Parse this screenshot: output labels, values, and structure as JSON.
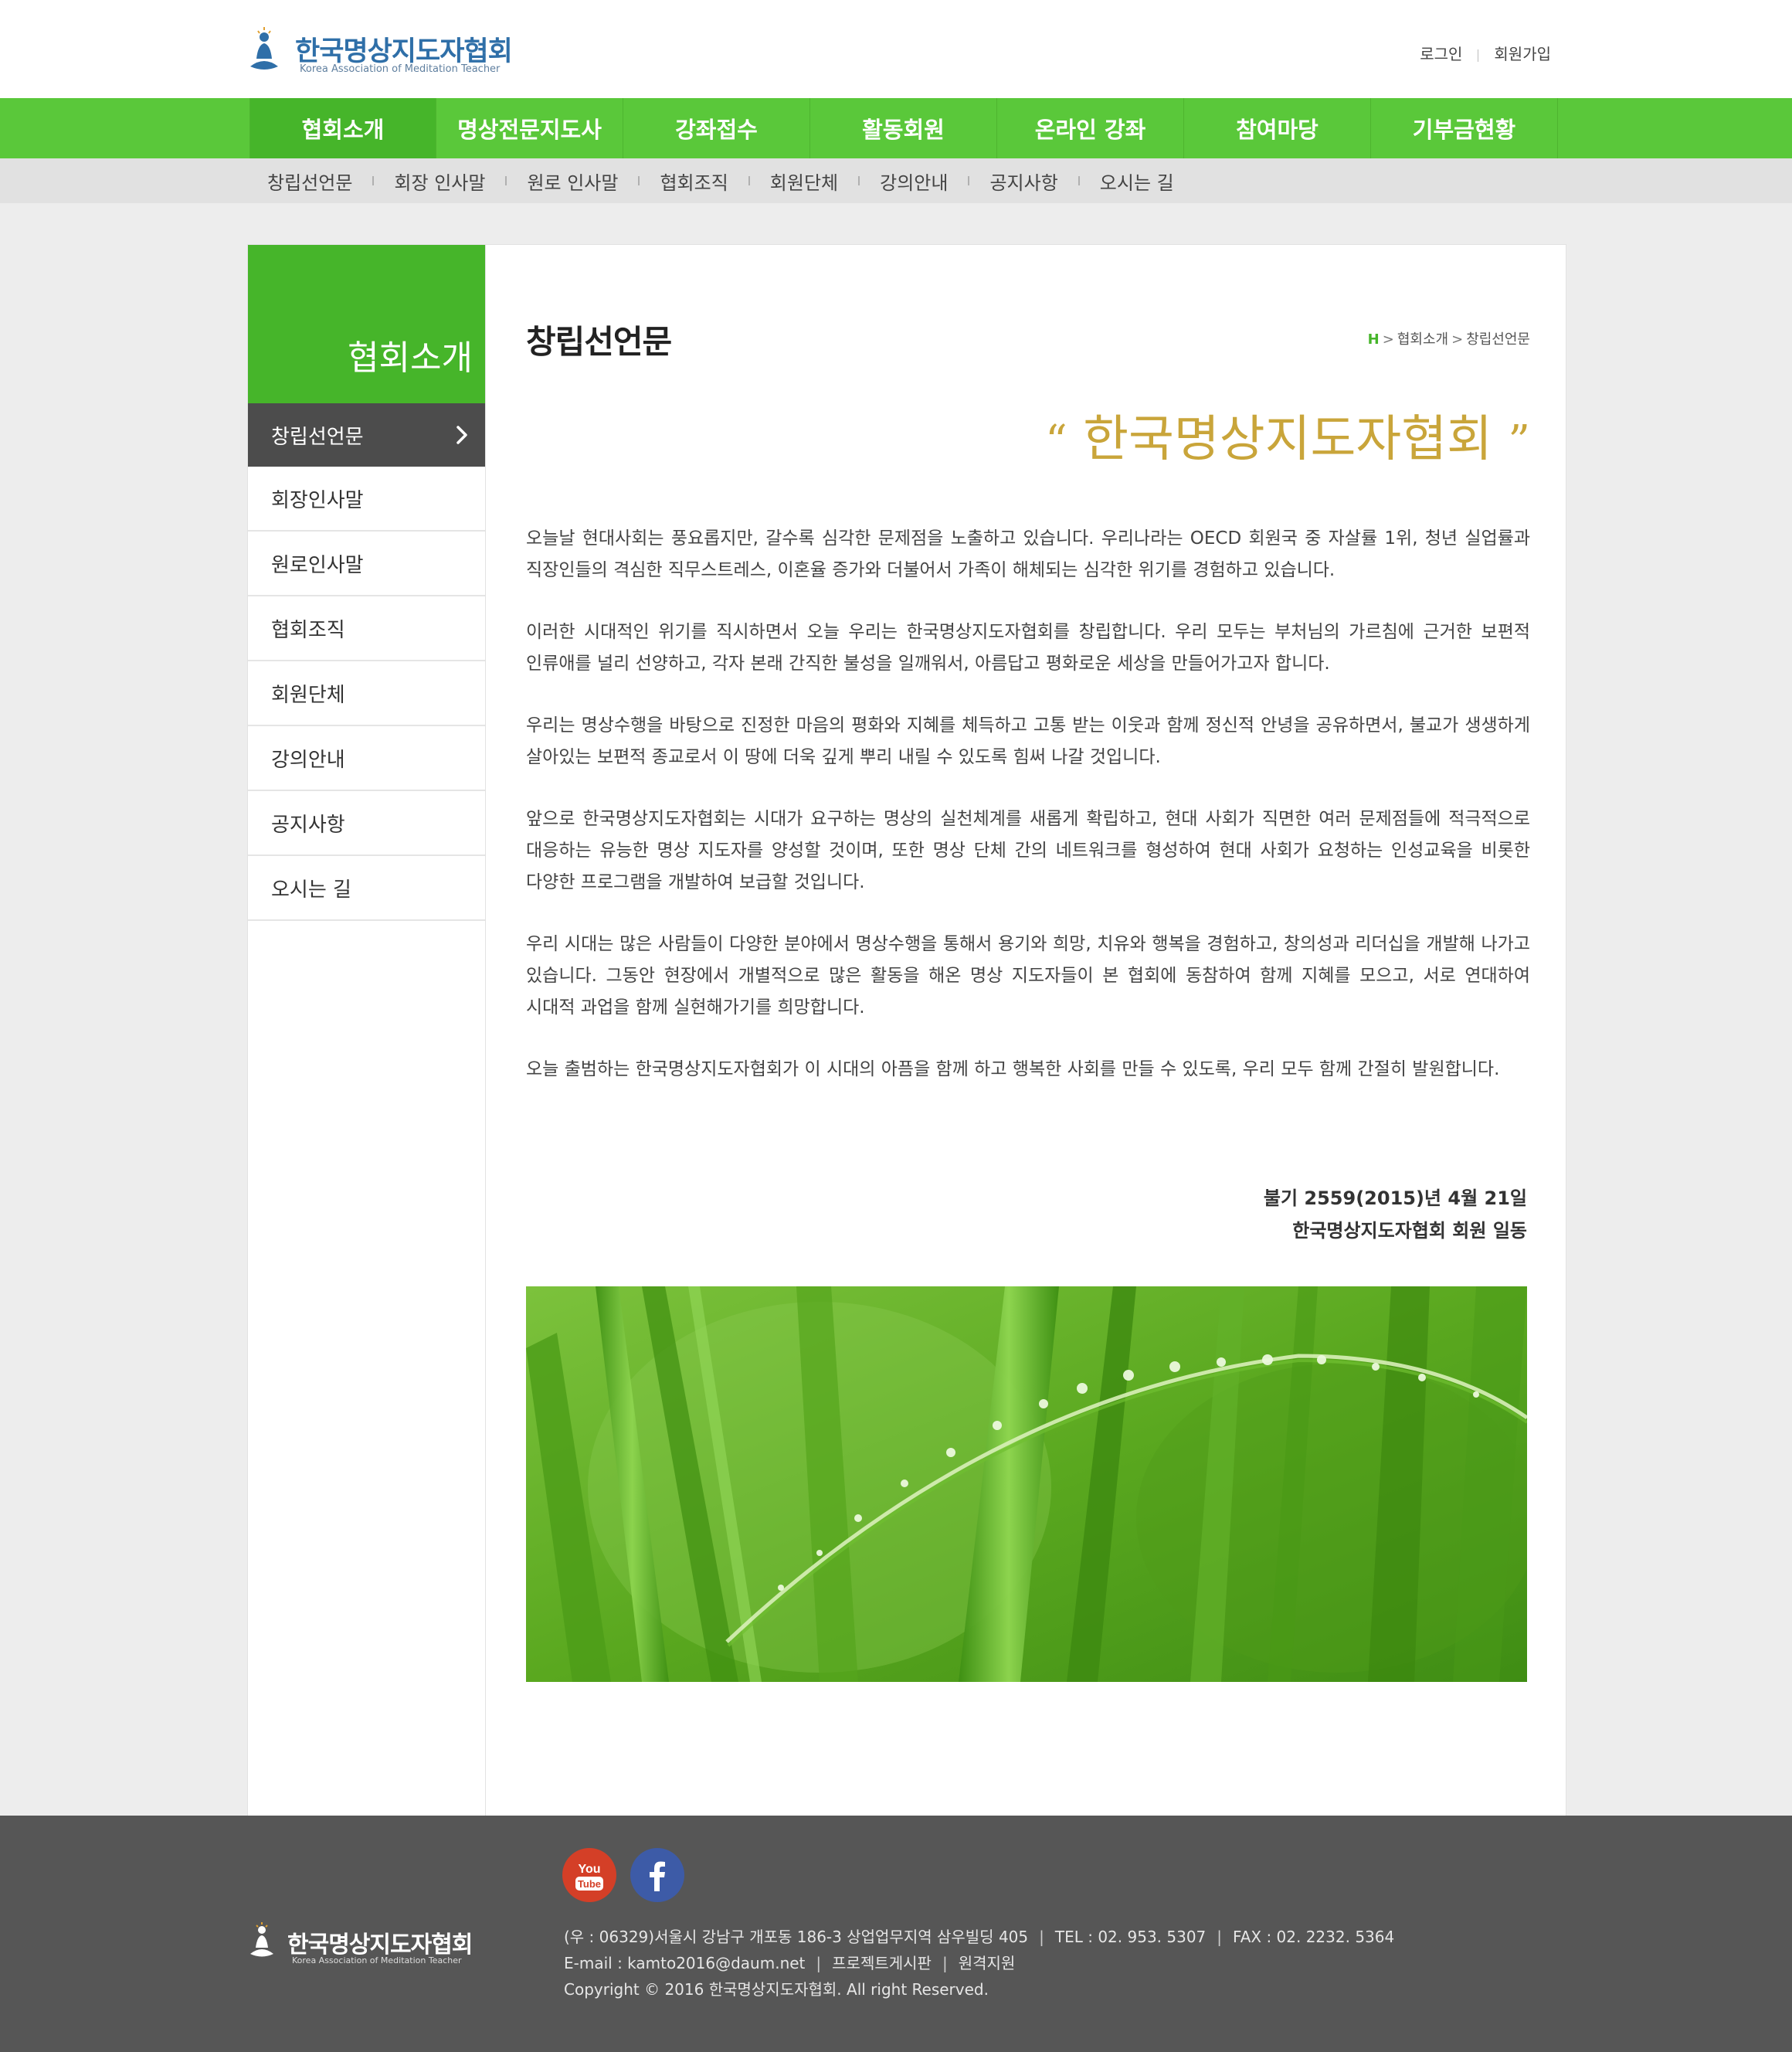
{
  "header": {
    "logo_ko": "한국명상지도자협회",
    "logo_en": "Korea Association of Meditation Teacher",
    "login": "로그인",
    "signup": "회원가입"
  },
  "gnb": {
    "items": [
      "협회소개",
      "명상전문지도사",
      "강좌접수",
      "활동회원",
      "온라인 강좌",
      "참여마당",
      "기부금현황"
    ]
  },
  "subnav": {
    "items": [
      "창립선언문",
      "회장 인사말",
      "원로 인사말",
      "협회조직",
      "회원단체",
      "강의안내",
      "공지사항",
      "오시는 길"
    ]
  },
  "lnb": {
    "title": "협회소개",
    "items": [
      "창립선언문",
      "회장인사말",
      "원로인사말",
      "협회조직",
      "회원단체",
      "강의안내",
      "공지사항",
      "오시는 길"
    ]
  },
  "main": {
    "title": "창립선언문",
    "breadcrumb": {
      "home": "H",
      "level1": "협회소개",
      "level2": "창립선언문"
    },
    "quote_open": "“",
    "quote": "한국명상지도자협회",
    "quote_close": "”",
    "paragraphs": [
      "오늘날 현대사회는 풍요롭지만, 갈수록 심각한 문제점을 노출하고 있습니다. 우리나라는 OECD 회원국 중 자살률 1위, 청년 실업률과 직장인들의 격심한 직무스트레스, 이혼율 증가와 더불어서 가족이 해체되는 심각한 위기를 경험하고 있습니다.",
      "이러한 시대적인 위기를 직시하면서 오늘 우리는 한국명상지도자협회를 창립합니다. 우리 모두는 부처님의 가르침에 근거한 보편적 인류애를 널리 선양하고, 각자 본래 간직한 불성을 일깨워서, 아름답고 평화로운 세상을 만들어가고자 합니다.",
      "우리는 명상수행을 바탕으로 진정한 마음의 평화와 지혜를 체득하고 고통 받는 이웃과 함께 정신적 안녕을 공유하면서, 불교가 생생하게 살아있는 보편적 종교로서 이 땅에 더욱 깊게 뿌리 내릴 수 있도록 힘써 나갈 것입니다.",
      "앞으로 한국명상지도자협회는 시대가 요구하는 명상의 실천체계를 새롭게 확립하고, 현대 사회가 직면한 여러 문제점들에 적극적으로 대응하는 유능한 명상 지도자를 양성할 것이며, 또한 명상 단체 간의 네트워크를 형성하여 현대 사회가 요청하는 인성교육을 비롯한 다양한 프로그램을 개발하여 보급할 것입니다.",
      "우리 시대는 많은 사람들이 다양한 분야에서 명상수행을 통해서 용기와 희망, 치유와 행복을 경험하고, 창의성과 리더십을 개발해 나가고 있습니다. 그동안 현장에서 개별적으로 많은 활동을 해온 명상 지도자들이 본 협회에 동참하여 함께 지혜를 모으고, 서로 연대하여 시대적 과업을 함께 실현해가기를 희망합니다.",
      "오늘 출범하는 한국명상지도자협회가 이 시대의 아픔을 함께 하고 행복한 사회를 만들 수 있도록, 우리 모두 함께 간절히 발원합니다."
    ],
    "sign_date": "불기 2559(2015)년 4월 21일",
    "sign_name": "한국명상지도자협회 회원 일동"
  },
  "footer": {
    "youtube_label": "You Tube",
    "logo_ko": "한국명상지도자협회",
    "logo_en": "Korea Association of Meditation Teacher",
    "address": "(우 : 06329)서울시 강남구 개포동 186-3 상업업무지역 삼우빌딩 405",
    "tel": "TEL : 02. 953. 5307",
    "fax": "FAX : 02. 2232. 5364",
    "email": "E-mail : kamto2016@daum.net",
    "link1": "프로젝트게시판",
    "link2": "원격지원",
    "copyright": "Copyright © 2016 한국명상지도자협회. All right Reserved."
  },
  "colors": {
    "brand_green": "#5ac83a",
    "dark_green": "#46b52a",
    "quote_gold": "#c9a53a",
    "footer_bg": "#565656"
  }
}
